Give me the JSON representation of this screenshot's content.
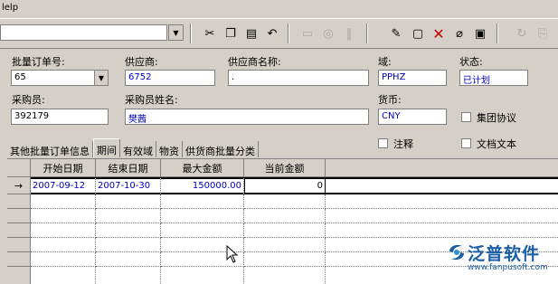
{
  "menu": {
    "help_fragment": "lelp"
  },
  "toolbar": {
    "icons": [
      "cut-icon",
      "copy-icon",
      "paste-icon",
      "undo-icon",
      "grid-icon",
      "circle-icon",
      "attach-icon",
      "new-icon",
      "folder-icon",
      "delete-icon",
      "eraser-icon",
      "save-icon",
      "refresh-icon",
      "print-icon"
    ],
    "delete_color": "#c00000"
  },
  "form": {
    "po_number_label": "批量订单号:",
    "po_number_value": "65",
    "supplier_label": "供应商:",
    "supplier_value": "6752",
    "supplier_name_label": "供应商名称:",
    "supplier_name_value": ".",
    "domain_label": "域:",
    "domain_value": "PPHZ",
    "status_label": "状态:",
    "status_value": "已计划",
    "buyer_label": "采购员:",
    "buyer_value": "392179",
    "buyer_name_label": "采购员姓名:",
    "buyer_name_value": "樊茜",
    "currency_label": "货币:",
    "currency_value": "CNY",
    "group_agreement_label": "集团协议",
    "note_label": "注释",
    "doc_text_label": "文档文本"
  },
  "tabs": [
    "其他批量订单信息",
    "期间",
    "有效域",
    "物资",
    "供货商批量分类"
  ],
  "active_tab": 1,
  "grid": {
    "columns": [
      "开始日期",
      "结束日期",
      "最大金额",
      "当前金额"
    ],
    "rows": [
      {
        "start": "2007-09-12",
        "end": "2007-10-30",
        "max": "150000.00",
        "current": "0"
      }
    ],
    "row_indicator": "→"
  },
  "watermark": {
    "brand": "泛普软件",
    "url": "www.fanpusoft.com"
  }
}
